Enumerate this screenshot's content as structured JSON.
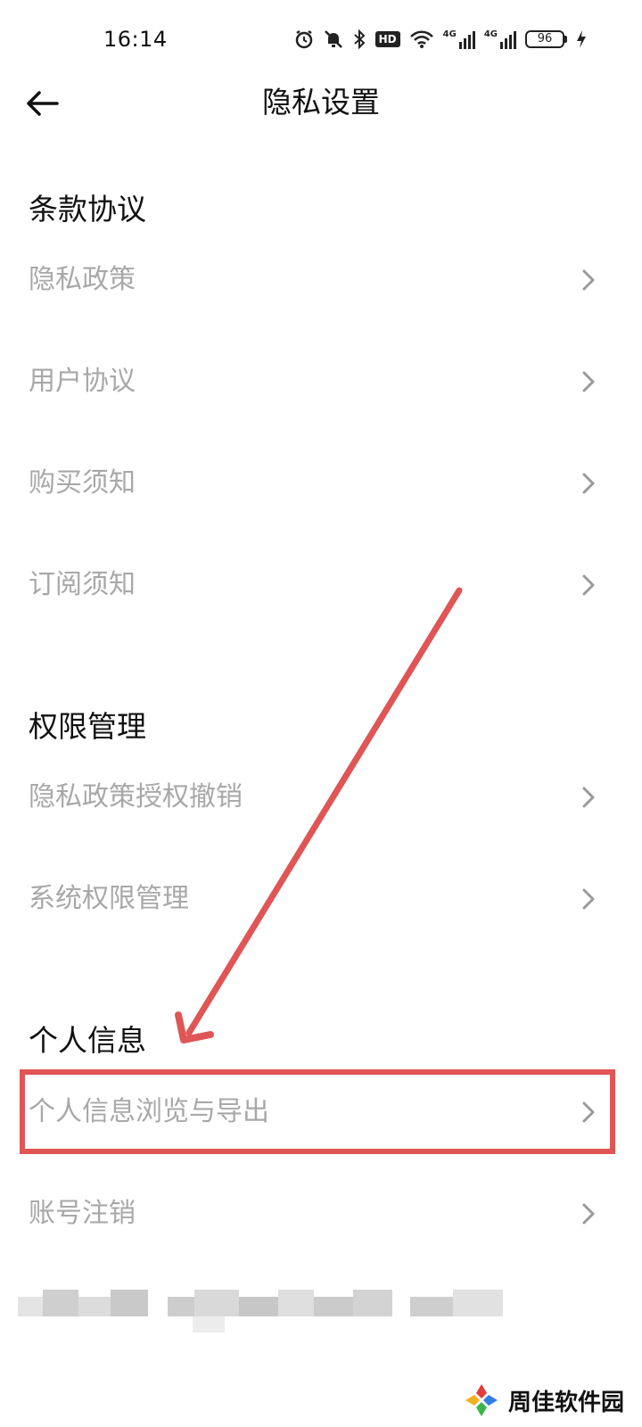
{
  "status_bar": {
    "time": "16:14",
    "battery_level": "96",
    "hd_label": "HD",
    "network_label_1": "4G",
    "network_label_2": "4G"
  },
  "header": {
    "title": "隐私设置"
  },
  "sections": [
    {
      "title": "条款协议",
      "items": [
        {
          "label": "隐私政策"
        },
        {
          "label": "用户协议"
        },
        {
          "label": "购买须知"
        },
        {
          "label": "订阅须知"
        }
      ]
    },
    {
      "title": "权限管理",
      "items": [
        {
          "label": "隐私政策授权撤销"
        },
        {
          "label": "系统权限管理"
        }
      ]
    },
    {
      "title": "个人信息",
      "items": [
        {
          "label": "个人信息浏览与导出"
        },
        {
          "label": "账号注销"
        }
      ]
    }
  ],
  "watermark": {
    "text": "周佳软件园"
  },
  "colors": {
    "annotation": "#e05555",
    "label_gray": "#a8a8a8",
    "title_dark": "#111111"
  }
}
